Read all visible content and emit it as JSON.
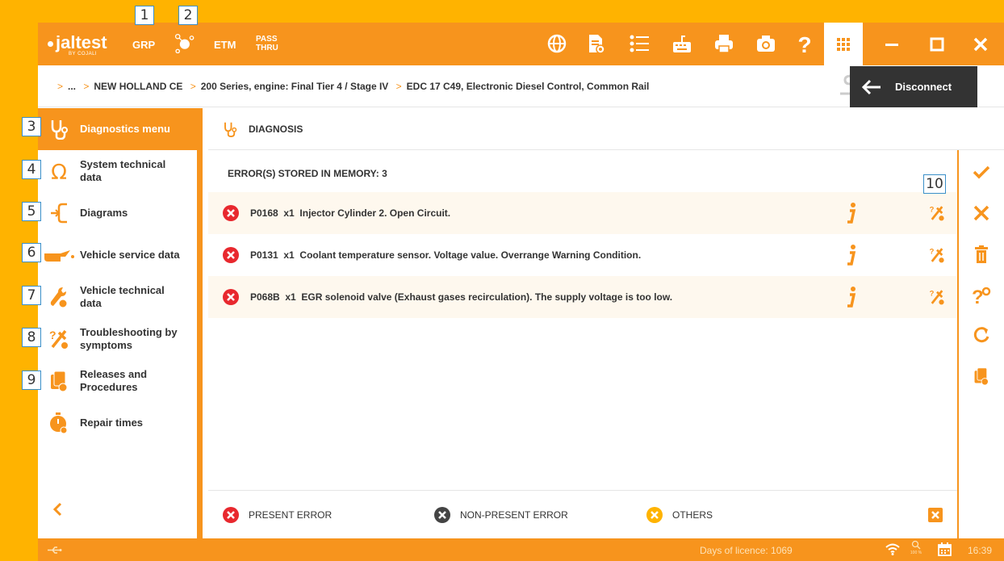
{
  "app": {
    "logo_main": "jaltest",
    "logo_sub": "BY COJALI"
  },
  "toolbar": {
    "grp": "GRP",
    "etm": "ETM",
    "pass_line1": "PASS",
    "pass_line2": "THRU",
    "icons": [
      "globe-icon",
      "document-view-icon",
      "list-icon",
      "keyboard-icon",
      "printer-icon",
      "camera-icon",
      "help-icon",
      "apps-grid-icon",
      "minimize-icon",
      "maximize-icon",
      "close-icon"
    ]
  },
  "breadcrumb": {
    "items": [
      "...",
      "NEW HOLLAND CE",
      "200 Series, engine: Final Tier 4 / Stage IV",
      "EDC 17 C49, Electronic Diesel Control, Common Rail"
    ]
  },
  "disconnect": {
    "label": "Disconnect"
  },
  "sidebar": {
    "items": [
      {
        "label": "Diagnostics menu",
        "icon": "stethoscope-icon"
      },
      {
        "label": "System technical data",
        "icon": "omega-icon"
      },
      {
        "label": "Diagrams",
        "icon": "diagram-icon"
      },
      {
        "label": "Vehicle service data",
        "icon": "oil-can-icon"
      },
      {
        "label": "Vehicle technical data",
        "icon": "wrench-globe-icon"
      },
      {
        "label": "Troubleshooting by symptoms",
        "icon": "troubleshoot-icon"
      },
      {
        "label": "Releases and Procedures",
        "icon": "procedures-icon"
      },
      {
        "label": "Repair times",
        "icon": "stopwatch-icon"
      }
    ]
  },
  "callouts": [
    "1",
    "2",
    "3",
    "4",
    "5",
    "6",
    "7",
    "8",
    "9",
    "10"
  ],
  "main": {
    "header": "DIAGNOSIS",
    "errors_title": "ERROR(S) STORED IN MEMORY: 3",
    "errors": [
      {
        "code": "P0168",
        "count": "x1",
        "description": "Injector Cylinder 2. Open Circuit."
      },
      {
        "code": "P0131",
        "count": "x1",
        "description": "Coolant temperature sensor. Voltage value. Overrange Warning Condition."
      },
      {
        "code": "P068B",
        "count": "x1",
        "description": "EGR solenoid valve (Exhaust gases recirculation). The supply voltage is too low."
      }
    ]
  },
  "legend": {
    "present": "PRESENT ERROR",
    "non_present": "NON-PRESENT ERROR",
    "others": "OTHERS"
  },
  "status": {
    "licence": "Days of licence: 1069",
    "zoom": "100 %",
    "time": "16:39"
  },
  "colors": {
    "orange": "#F7941D",
    "yellow": "#FFB300",
    "red": "#E8282E",
    "dark": "#333333"
  }
}
